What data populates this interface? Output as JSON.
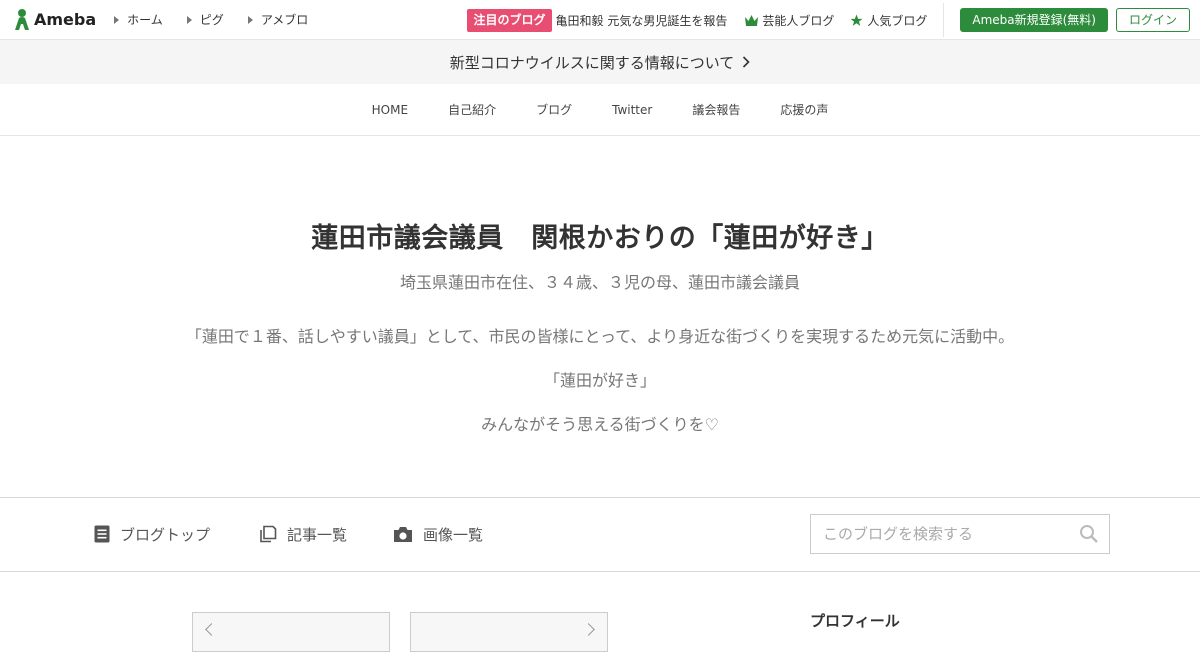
{
  "header": {
    "logo_text": "Ameba",
    "nav": [
      {
        "label": "ホーム"
      },
      {
        "label": "ピグ"
      },
      {
        "label": "アメブロ"
      }
    ],
    "featured_badge": "注目のブログ",
    "featured_text": "亀田和毅 元気な男児誕生を報告",
    "celebrity_blog": "芸能人ブログ",
    "popular_blog": "人気ブログ",
    "register_button": "Ameba新規登録(無料)",
    "login_button": "ログイン"
  },
  "notice": {
    "text": "新型コロナウイルスに関する情報について"
  },
  "blog_nav": [
    {
      "label": "HOME"
    },
    {
      "label": "自己紹介"
    },
    {
      "label": "ブログ"
    },
    {
      "label": "Twitter"
    },
    {
      "label": "議会報告"
    },
    {
      "label": "応援の声"
    }
  ],
  "hero": {
    "title": "蓮田市議会議員　関根かおりの「蓮田が好き」",
    "subtitle": "埼玉県蓮田市在住、３４歳、３児の母、蓮田市議会議員",
    "description_lines": [
      "「蓮田で１番、話しやすい議員」として、市民の皆様にとって、より身近な街づくりを実現するため元気に活動中。",
      "「蓮田が好き」",
      "みんながそう思える街づくりを♡"
    ]
  },
  "toolbar": {
    "blog_top": "ブログトップ",
    "article_list": "記事一覧",
    "image_list": "画像一覧",
    "search_placeholder": "このブログを検索する"
  },
  "sidebar": {
    "profile_heading": "プロフィール"
  },
  "colors": {
    "brand_green": "#2d8c3c",
    "featured_pink": "#e84d72"
  }
}
